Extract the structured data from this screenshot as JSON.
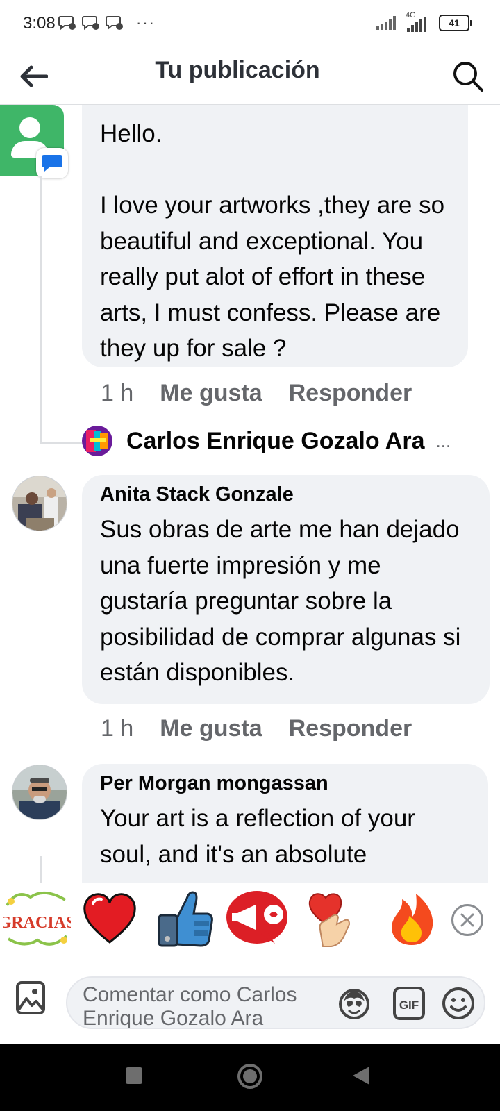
{
  "status_bar": {
    "time": "3:08",
    "more": "···",
    "network_type": "4G",
    "battery_level": "41"
  },
  "header": {
    "title": "Tu publicación"
  },
  "comments": [
    {
      "author": "",
      "text": "Hello.\n\nI love your artworks ,they are so beautiful and exceptional. You really put alot of effort in these arts, I must confess. Please are they up for sale ?",
      "time": "1 h",
      "like_label": "Me gusta",
      "reply_label": "Responder",
      "reply_preview": {
        "name": "Carlos Enrique Gozalo Ara",
        "more": "..."
      }
    },
    {
      "author": "Anita Stack Gonzale",
      "text": "Sus obras de arte me han dejado una fuerte impresión y me gustaría preguntar sobre la posibilidad de comprar algunas si están disponibles.",
      "time": "1 h",
      "like_label": "Me gusta",
      "reply_label": "Responder"
    },
    {
      "author": "Per Morgan mongassan",
      "text": "Your art is a reflection of your soul, and it's an absolute"
    }
  ],
  "stickers": [
    {
      "name": "gracias-sticker",
      "text": "GRACIAS"
    },
    {
      "name": "red-heart-sticker"
    },
    {
      "name": "robot-thumbs-up-sticker"
    },
    {
      "name": "megaphone-sticker"
    },
    {
      "name": "heart-hand-sticker"
    },
    {
      "name": "fire-sticker"
    }
  ],
  "composer": {
    "placeholder": "Comentar como Carlos Enrique Gozalo Ara",
    "gif_label": "GIF"
  },
  "colors": {
    "bubble": "#f0f2f5",
    "secondary_text": "#65676b",
    "messages_avatar": "#3fb668"
  }
}
